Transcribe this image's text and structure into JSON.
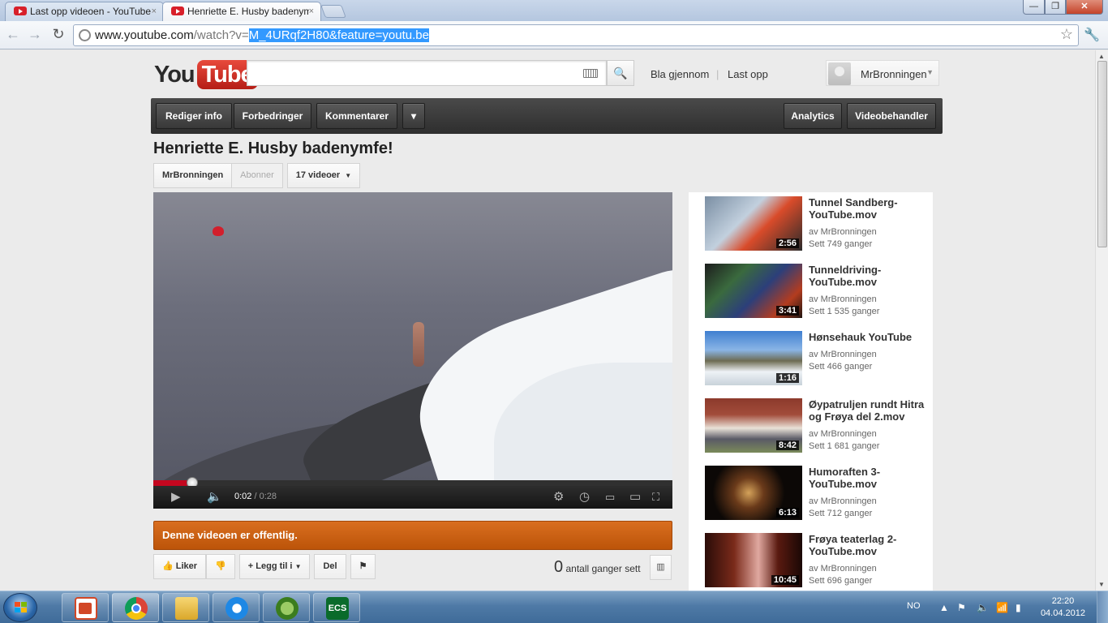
{
  "browser": {
    "tabs": [
      {
        "title": "Last opp videoen - YouTube",
        "close": "×",
        "active": false
      },
      {
        "title": "Henriette E. Husby badenymfe!",
        "close": "×",
        "active": true
      }
    ],
    "url_prefix": "www.youtube.com",
    "url_path": "/watch?v=",
    "url_selected": "M_4URqf2H80&feature=youtu.be",
    "window_buttons": {
      "minimize": "—",
      "maximize": "❐",
      "close": "✕"
    }
  },
  "header": {
    "logo_you": "You",
    "logo_tube": "Tube",
    "search_placeholder": "",
    "links": {
      "browse": "Bla gjennom",
      "upload": "Last opp",
      "separator": "|"
    },
    "user": {
      "name": "MrBronningen"
    }
  },
  "owner_bar": {
    "edit_info": "Rediger info",
    "enhancements": "Forbedringer",
    "comments": "Kommentarer",
    "more": "▾",
    "analytics": "Analytics",
    "video_manager": "Videobehandler"
  },
  "video": {
    "title": "Henriette E. Husby badenymfe!",
    "channel": "MrBronningen",
    "subscribe": "Abonner",
    "video_count": "17 videoer",
    "current_time": "0:02",
    "time_separator": "/",
    "duration": "0:28",
    "progress_fraction": 0.075,
    "status_message": "Denne videoen er offentlig."
  },
  "actions": {
    "like": "Liker",
    "add_to": "Legg til i",
    "share": "Del",
    "view_count": "0",
    "view_label": "antall ganger sett"
  },
  "related": [
    {
      "title": "Tunnel Sandberg-YouTube.mov",
      "by": "av MrBronningen",
      "views": "Sett 749 ganger",
      "duration": "2:56"
    },
    {
      "title": "Tunneldriving-YouTube.mov",
      "by": "av MrBronningen",
      "views": "Sett 1 535 ganger",
      "duration": "3:41"
    },
    {
      "title": "Hønsehauk YouTube",
      "by": "av MrBronningen",
      "views": "Sett 466 ganger",
      "duration": "1:16"
    },
    {
      "title": "Øypatruljen rundt Hitra og Frøya del 2.mov",
      "by": "av MrBronningen",
      "views": "Sett 1 681 ganger",
      "duration": "8:42"
    },
    {
      "title": "Humoraften 3-YouTube.mov",
      "by": "av MrBronningen",
      "views": "Sett 712 ganger",
      "duration": "6:13"
    },
    {
      "title": "Frøya teaterlag 2-YouTube.mov",
      "by": "av MrBronningen",
      "views": "Sett 696 ganger",
      "duration": "10:45"
    }
  ],
  "taskbar": {
    "apps": [
      "powerpoint-icon",
      "chrome-icon",
      "explorer-icon",
      "ie-icon",
      "spotify-icon",
      "ecs-icon"
    ],
    "ecs_label": "ECS",
    "language": "NO",
    "time": "22:20",
    "date": "04.04.2012"
  }
}
